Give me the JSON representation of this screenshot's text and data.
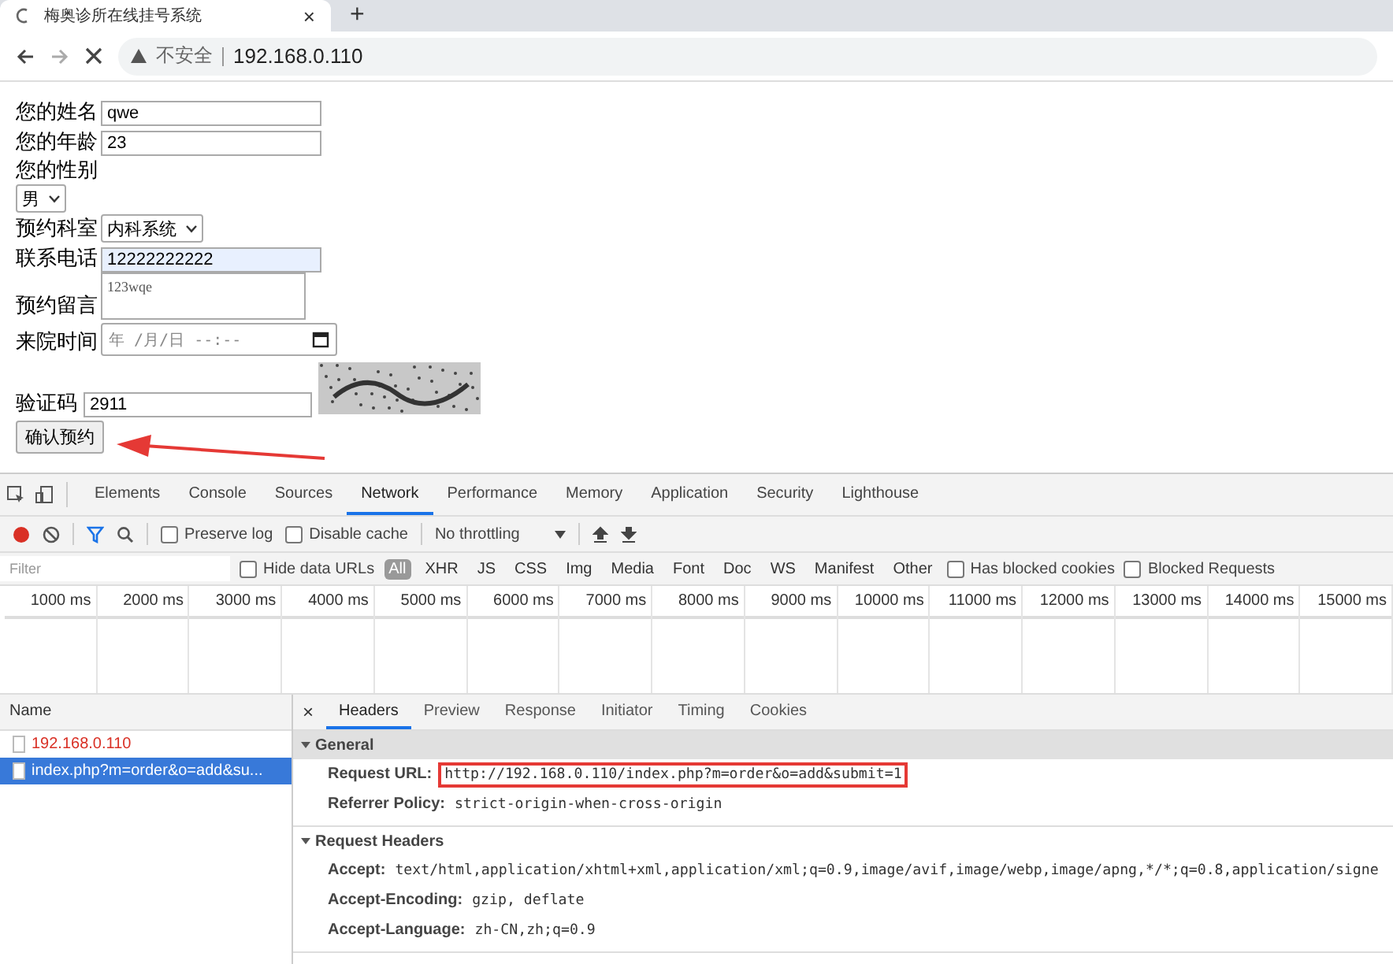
{
  "browser": {
    "tab_title": "梅奥诊所在线挂号系统",
    "new_tab": "+",
    "close": "×",
    "security": "不安全",
    "url": "192.168.0.110"
  },
  "form": {
    "fields": [
      {
        "kind": "text",
        "label": "您的姓名",
        "value": "qwe",
        "autofilled": false
      },
      {
        "kind": "text",
        "label": "您的年龄",
        "value": "23",
        "autofilled": false
      },
      {
        "kind": "select",
        "label": "您的性别",
        "value": "男"
      },
      {
        "kind": "select",
        "label": "预约科室",
        "value": "内科系统"
      },
      {
        "kind": "text",
        "label": "联系电话",
        "value": "12222222222",
        "autofilled": true
      },
      {
        "kind": "textarea",
        "label": "预约留言",
        "value": "123wqe"
      },
      {
        "kind": "date",
        "label": "来院时间",
        "placeholder": "年 /月/日 --:--"
      },
      {
        "kind": "captcha",
        "label": "验证码",
        "value": "2911"
      }
    ],
    "submit": "确认预约",
    "annotation_arrow": true
  },
  "devtools": {
    "panel_tabs": [
      {
        "label": "Elements",
        "selected": false
      },
      {
        "label": "Console",
        "selected": false
      },
      {
        "label": "Sources",
        "selected": false
      },
      {
        "label": "Network",
        "selected": true
      },
      {
        "label": "Performance",
        "selected": false
      },
      {
        "label": "Memory",
        "selected": false
      },
      {
        "label": "Application",
        "selected": false
      },
      {
        "label": "Security",
        "selected": false
      },
      {
        "label": "Lighthouse",
        "selected": false
      }
    ],
    "toolbar": {
      "recording": true,
      "preserve_log": {
        "label": "Preserve log",
        "checked": false
      },
      "disable_cache": {
        "label": "Disable cache",
        "checked": false
      },
      "throttling": "No throttling"
    },
    "filter": {
      "placeholder": "Filter",
      "hide_data_urls": {
        "label": "Hide data URLs",
        "checked": false
      },
      "types": [
        {
          "label": "All",
          "selected": true
        },
        {
          "label": "XHR",
          "selected": false
        },
        {
          "label": "JS",
          "selected": false
        },
        {
          "label": "CSS",
          "selected": false
        },
        {
          "label": "Img",
          "selected": false
        },
        {
          "label": "Media",
          "selected": false
        },
        {
          "label": "Font",
          "selected": false
        },
        {
          "label": "Doc",
          "selected": false
        },
        {
          "label": "WS",
          "selected": false
        },
        {
          "label": "Manifest",
          "selected": false
        },
        {
          "label": "Other",
          "selected": false
        }
      ],
      "options": [
        {
          "label": "Has blocked cookies",
          "checked": false
        },
        {
          "label": "Blocked Requests",
          "checked": false
        }
      ]
    },
    "timeline_ticks": [
      "1000 ms",
      "2000 ms",
      "3000 ms",
      "4000 ms",
      "5000 ms",
      "6000 ms",
      "7000 ms",
      "8000 ms",
      "9000 ms",
      "10000 ms",
      "11000 ms",
      "12000 ms",
      "13000 ms",
      "14000 ms",
      "15000 ms"
    ],
    "requests": {
      "column": "Name",
      "rows": [
        {
          "name": "192.168.0.110",
          "failed": true,
          "selected": false
        },
        {
          "name": "index.php?m=order&o=add&su...",
          "failed": false,
          "selected": true
        }
      ]
    },
    "detail": {
      "close": "×",
      "tabs": [
        {
          "label": "Headers",
          "selected": true
        },
        {
          "label": "Preview",
          "selected": false
        },
        {
          "label": "Response",
          "selected": false
        },
        {
          "label": "Initiator",
          "selected": false
        },
        {
          "label": "Timing",
          "selected": false
        },
        {
          "label": "Cookies",
          "selected": false
        }
      ],
      "sections": [
        {
          "title": "General",
          "expanded": true,
          "rows": [
            {
              "key": "Request URL:",
              "value": "http://192.168.0.110/index.php?m=order&o=add&submit=1",
              "boxed": true
            },
            {
              "key": "Referrer Policy:",
              "value": "strict-origin-when-cross-origin",
              "boxed": false
            }
          ]
        },
        {
          "title": "Request Headers",
          "expanded": true,
          "rows": [
            {
              "key": "Accept:",
              "value": "text/html,application/xhtml+xml,application/xml;q=0.9,image/avif,image/webp,image/apng,*/*;q=0.8,application/signe",
              "boxed": false
            },
            {
              "key": "Accept-Encoding:",
              "value": "gzip, deflate",
              "boxed": false
            },
            {
              "key": "Accept-Language:",
              "value": "zh-CN,zh;q=0.9",
              "boxed": false
            }
          ]
        }
      ]
    }
  }
}
